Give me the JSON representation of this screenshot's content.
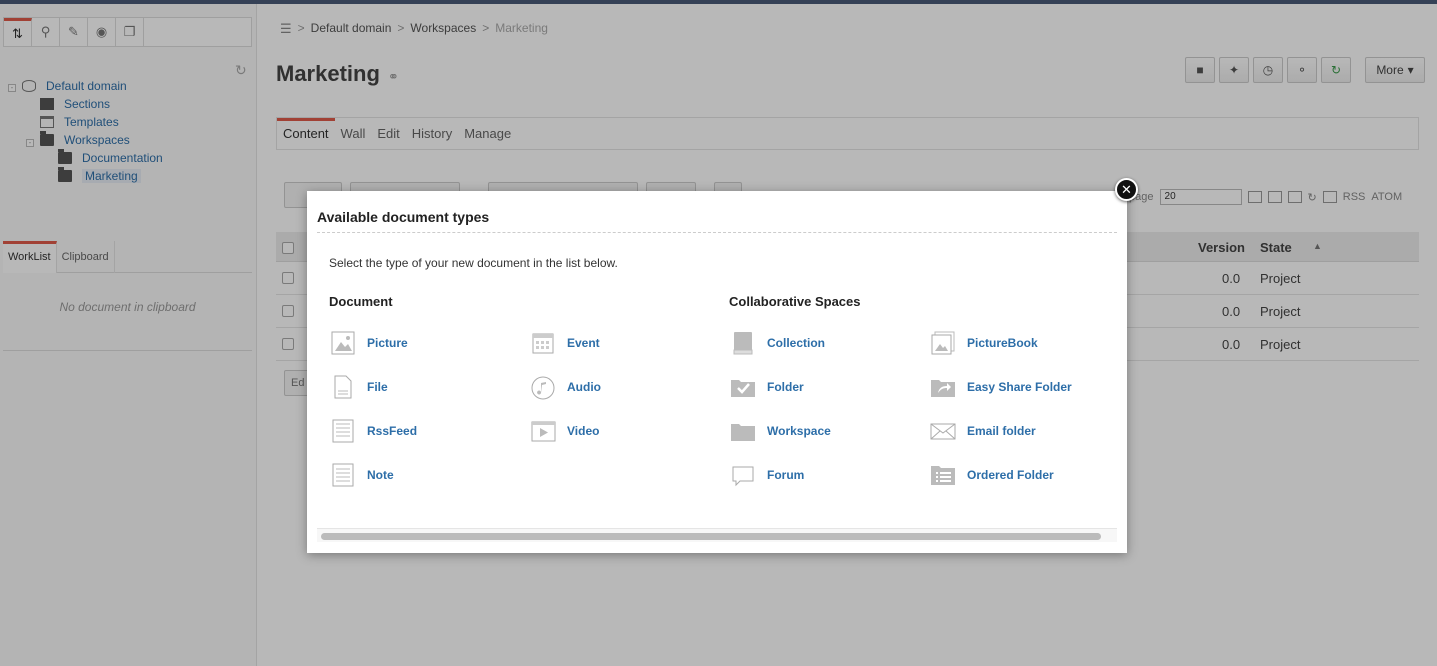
{
  "left_panel": {
    "tool_tabs": [
      "browse-icon",
      "search-icon",
      "edit-icon",
      "location-icon",
      "copy-icon"
    ],
    "tree": [
      {
        "label": "Default domain",
        "icon": "database-icon"
      },
      {
        "label": "Sections",
        "icon": "sections-icon"
      },
      {
        "label": "Templates",
        "icon": "templates-icon"
      },
      {
        "label": "Workspaces",
        "icon": "folder-icon"
      },
      {
        "label": "Documentation",
        "icon": "folder-icon"
      },
      {
        "label": "Marketing",
        "icon": "folder-icon"
      }
    ],
    "worklist_tabs": [
      "WorkList",
      "Clipboard"
    ],
    "clipboard_message": "No document in clipboard"
  },
  "main": {
    "breadcrumb": [
      "Default domain",
      "Workspaces",
      "Marketing"
    ],
    "title": "Marketing",
    "actions": [
      "book-icon",
      "pin-icon",
      "clock-icon",
      "share-icon",
      "refresh-icon"
    ],
    "more_label": "More",
    "tabs": [
      "Content",
      "Wall",
      "Edit",
      "History",
      "Manage"
    ],
    "pager": {
      "label": "/page",
      "page_size": "20",
      "rss": "RSS",
      "atom": "ATOM"
    },
    "table": {
      "headers": {
        "version": "Version",
        "state": "State"
      },
      "rows": [
        {
          "version": "0.0",
          "state": "Project"
        },
        {
          "version": "0.0",
          "state": "Project"
        },
        {
          "version": "0.0",
          "state": "Project"
        }
      ],
      "edit_label": "Ed"
    }
  },
  "modal": {
    "title": "Available document types",
    "intro": "Select the type of your new document in the list below.",
    "groups": [
      {
        "title": "Document",
        "col1": [
          {
            "label": "Picture",
            "icon": "picture-icon"
          },
          {
            "label": "File",
            "icon": "file-icon"
          },
          {
            "label": "RssFeed",
            "icon": "rssfeed-icon"
          },
          {
            "label": "Note",
            "icon": "note-icon"
          }
        ],
        "col2": [
          {
            "label": "Event",
            "icon": "event-icon"
          },
          {
            "label": "Audio",
            "icon": "audio-icon"
          },
          {
            "label": "Video",
            "icon": "video-icon"
          }
        ]
      },
      {
        "title": "Collaborative Spaces",
        "col1": [
          {
            "label": "Collection",
            "icon": "collection-icon"
          },
          {
            "label": "Folder",
            "icon": "folder-icon"
          },
          {
            "label": "Workspace",
            "icon": "workspace-icon"
          },
          {
            "label": "Forum",
            "icon": "forum-icon"
          }
        ],
        "col2": [
          {
            "label": "PictureBook",
            "icon": "picturebook-icon"
          },
          {
            "label": "Easy Share Folder",
            "icon": "easy-share-folder-icon"
          },
          {
            "label": "Email folder",
            "icon": "email-folder-icon"
          },
          {
            "label": "Ordered Folder",
            "icon": "ordered-folder-icon"
          }
        ]
      }
    ]
  }
}
